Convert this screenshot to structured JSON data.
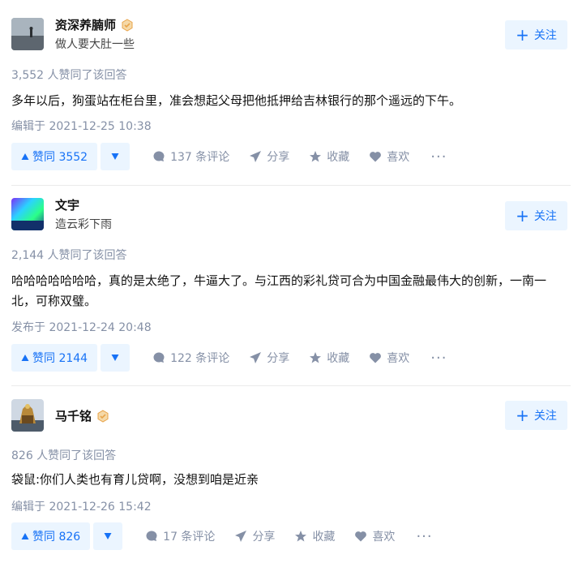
{
  "answers": [
    {
      "author": "资深养腩师",
      "headline": "做人要大肚一些",
      "follow_label": "关注",
      "vote_summary": "3,552 人赞同了该回答",
      "content": "多年以后，狗蛋站在柜台里，准会想起父母把他抵押给吉林银行的那个遥远的下午。",
      "date": "编辑于 2021-12-25 10:38",
      "upvote_label": "赞同 3552",
      "comment_label": "137 条评论",
      "share_label": "分享",
      "collect_label": "收藏",
      "like_label": "喜欢",
      "more_label": "···"
    },
    {
      "author": "文宇",
      "headline": "造云彩下雨",
      "follow_label": "关注",
      "vote_summary": "2,144 人赞同了该回答",
      "content": "哈哈哈哈哈哈哈，真的是太绝了，牛逼大了。与江西的彩礼贷可合为中国金融最伟大的创新，一南一北，可称双璧。",
      "date": "发布于 2021-12-24 20:48",
      "upvote_label": "赞同 2144",
      "comment_label": "122 条评论",
      "share_label": "分享",
      "collect_label": "收藏",
      "like_label": "喜欢",
      "more_label": "···"
    },
    {
      "author": "马千铭",
      "headline": "",
      "follow_label": "关注",
      "vote_summary": "826 人赞同了该回答",
      "content": "袋鼠:你们人类也有育儿贷啊，没想到咱是近亲",
      "date": "编辑于 2021-12-26 15:42",
      "upvote_label": "赞同 826",
      "comment_label": "17 条评论",
      "share_label": "分享",
      "collect_label": "收藏",
      "like_label": "喜欢",
      "more_label": "···"
    }
  ],
  "colors": {
    "accent": "#1772f6",
    "accent_bg": "#ebf5ff",
    "muted": "#8590a6",
    "badge": "#e8a44a"
  },
  "icons": [
    "verified-badge-icon",
    "plus-icon",
    "triangle-up-icon",
    "triangle-down-icon",
    "comment-icon",
    "share-icon",
    "star-icon",
    "heart-icon",
    "more-icon"
  ]
}
